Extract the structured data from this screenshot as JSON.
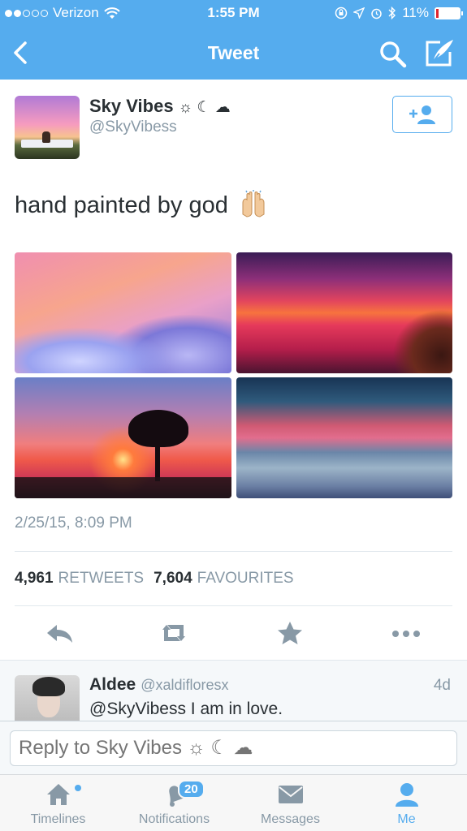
{
  "status_bar": {
    "carrier": "Verizon",
    "time": "1:55 PM",
    "battery_percent": "11%"
  },
  "nav": {
    "title": "Tweet"
  },
  "tweet": {
    "author_name": "Sky Vibes",
    "author_name_symbols": "☼ ☾ ☁",
    "author_handle": "@SkyVibess",
    "text": "hand painted by god",
    "emoji": "raised-hands-emoji",
    "timestamp": "2/25/15, 8:09 PM",
    "retweets_count": "4,961",
    "retweets_label": "RETWEETS",
    "favourites_count": "7,604",
    "favourites_label": "FAVOURITES",
    "photos": [
      {
        "subject": "pink-clouds-photo"
      },
      {
        "subject": "red-sunset-lake-photo"
      },
      {
        "subject": "tree-sunset-photo"
      },
      {
        "subject": "beach-dusk-photo"
      }
    ]
  },
  "reply": {
    "name": "Aldee",
    "handle": "@xaldifloresx",
    "age": "4d",
    "text": "@SkyVibess I am in love."
  },
  "reply_input": {
    "placeholder": "Reply to Sky Vibes ☼ ☾ ☁"
  },
  "tabbar": {
    "tabs": [
      {
        "label": "Timelines",
        "icon": "home-icon"
      },
      {
        "label": "Notifications",
        "icon": "bell-icon",
        "badge": "20"
      },
      {
        "label": "Messages",
        "icon": "envelope-icon"
      },
      {
        "label": "Me",
        "icon": "person-icon",
        "active": true
      }
    ]
  },
  "colors": {
    "brand": "#55acee",
    "text": "#292f33",
    "muted": "#8899a6"
  }
}
